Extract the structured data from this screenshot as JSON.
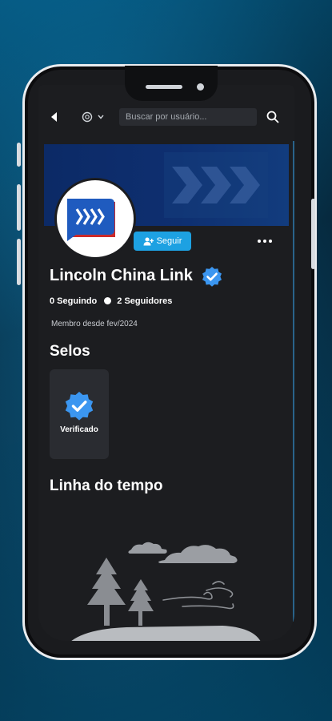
{
  "header": {
    "search_placeholder": "Buscar por usuário..."
  },
  "profile": {
    "name": "Lincoln China Link",
    "follow_label": "Seguir",
    "following_count": "0 Seguindo",
    "followers_count": "2 Seguidores",
    "member_since": "Membro desde fev/2024"
  },
  "sections": {
    "badges_title": "Selos",
    "timeline_title": "Linha do tempo"
  },
  "badges": [
    {
      "label": "Verificado",
      "icon": "verified-check-icon"
    }
  ],
  "colors": {
    "accent": "#1da1e2",
    "verified": "#3b96f0",
    "screen_bg": "#1c1d20",
    "banner": "#0e2f70"
  }
}
